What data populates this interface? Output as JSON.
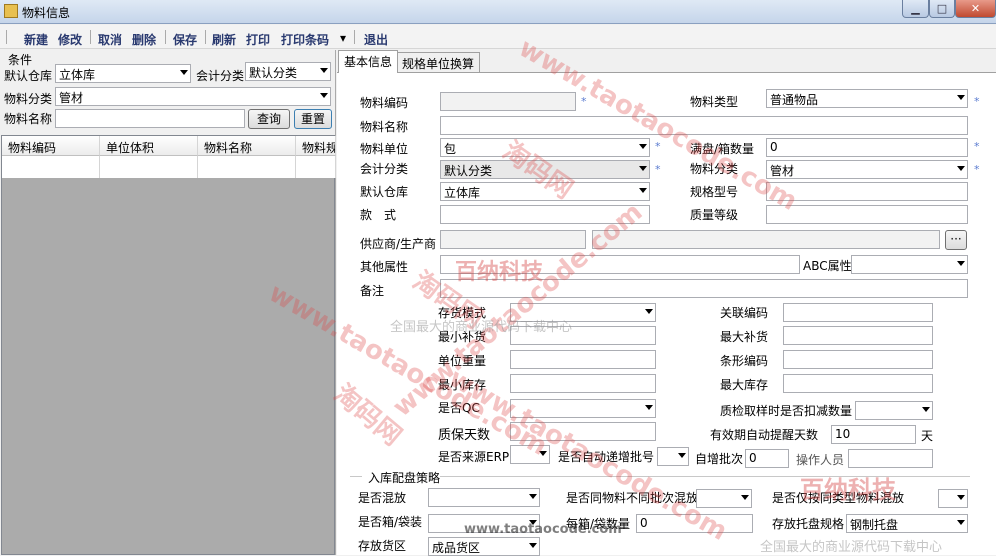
{
  "window": {
    "title": "物料信息",
    "min": "▁",
    "max": "□",
    "close": "✕"
  },
  "toolbar": [
    "新建",
    "修改",
    "取消",
    "删除",
    "保存",
    "刷新",
    "打印",
    "打印条码",
    "退出"
  ],
  "left": {
    "group_label": "条件",
    "warehouse_label": "默认仓库",
    "warehouse_value": "立体库",
    "acct_label": "会计分类",
    "acct_value": "默认分类",
    "category_label": "物料分类",
    "category_value": "管材",
    "name_label": "物料名称",
    "name_value": "",
    "query": "查询",
    "reset": "重置",
    "columns": [
      "物料编码",
      "单位体积",
      "物料名称",
      "物料规"
    ]
  },
  "tabs": [
    "基本信息",
    "规格单位换算"
  ],
  "form": {
    "code_label": "物料编码",
    "code_value": "",
    "type_label": "物料类型",
    "type_value": "普通物品",
    "name_label": "物料名称",
    "name_value": "",
    "unit_label": "物料单位",
    "unit_value": "包",
    "full_label": "满盘/箱数量",
    "full_value": "0",
    "acct_label": "会计分类",
    "acct_value": "默认分类",
    "cat_label": "物料分类",
    "cat_value": "管材",
    "wh_label": "默认仓库",
    "wh_value": "立体库",
    "spec_label": "规格型号",
    "style_label": "款　式",
    "quality_label": "质量等级",
    "supplier_label": "供应商/生产商",
    "supplier_btn": "···",
    "other_label": "其他属性",
    "abc_label": "ABC属性",
    "note_label": "备注",
    "stock_mode_label": "存货模式",
    "rel_code_label": "关联编码",
    "min_replen_label": "最小补货",
    "max_replen_label": "最大补货",
    "unit_weight_label": "单位重量",
    "barcode_label": "条形编码",
    "min_stock_label": "最小库存",
    "max_stock_label": "最大库存",
    "qc_label": "是否QC",
    "qc_deduct_label": "质检取样时是否扣减数量",
    "shelf_days_label": "质保天数",
    "expiry_label": "有效期自动提醒天数",
    "expiry_value": "10",
    "expiry_unit": "天",
    "erp_label": "是否来源ERP",
    "auto_batch_label": "是否自动递增批号",
    "auto_inc_label": "自增批次",
    "auto_inc_value": "0",
    "operator_label": "操作人员"
  },
  "inbound": {
    "group_label": "入库配盘策略",
    "mix_label": "是否混放",
    "diff_batch_label": "是否同物料不同批次混放",
    "same_type_label": "是否仅按同类型物料混放",
    "box_label": "是否箱/袋装",
    "per_box_label": "每箱/袋数量",
    "per_box_value": "0",
    "pallet_spec_label": "存放托盘规格",
    "pallet_spec_value": "钢制托盘",
    "area_label": "存放货区",
    "area_value": "成品货区"
  },
  "watermarks": {
    "site": "www.taotaocode.com",
    "cn": "淘码网",
    "brand": "百纳科技",
    "slogan": "全国最大的商业源代码下载中心",
    "bottom": "www.taotaocode.com"
  }
}
